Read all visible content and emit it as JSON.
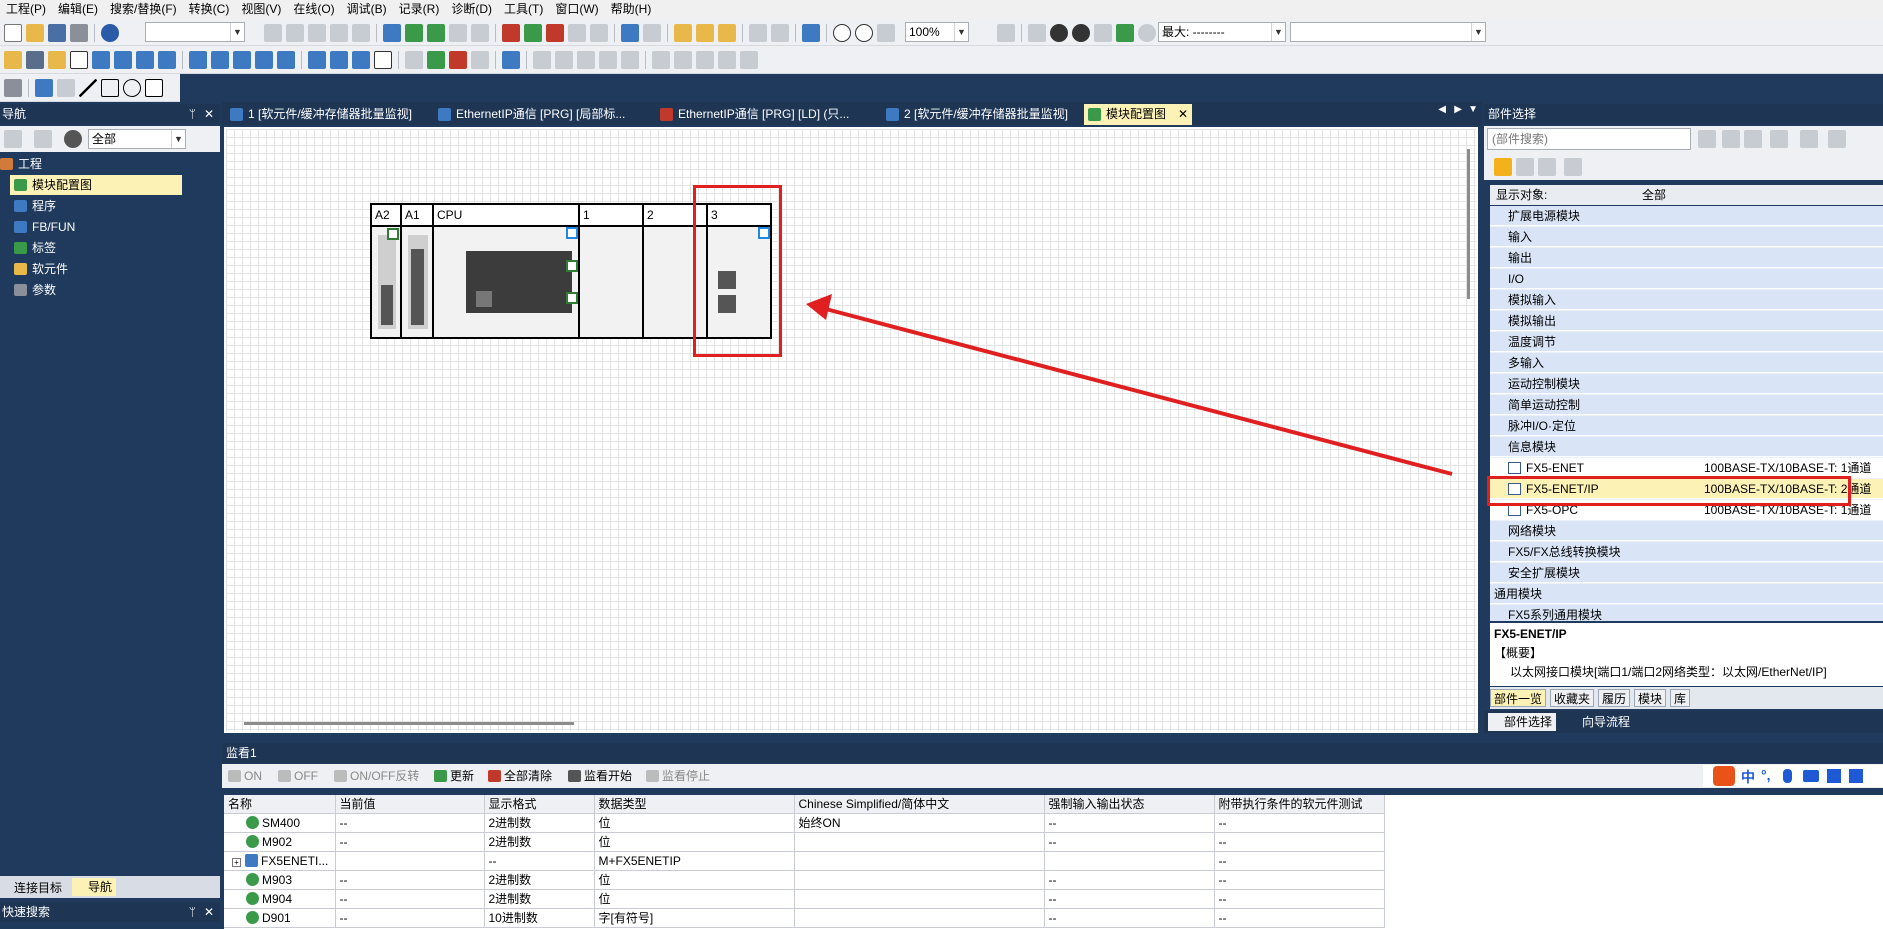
{
  "menu": [
    "工程(P)",
    "编辑(E)",
    "搜索/替换(F)",
    "转换(C)",
    "视图(V)",
    "在线(O)",
    "调试(B)",
    "记录(R)",
    "诊断(D)",
    "工具(T)",
    "窗口(W)",
    "帮助(H)"
  ],
  "toolbar": {
    "zoom": "100%",
    "max_label": "最大: --------"
  },
  "nav": {
    "title": "导航",
    "filter": "全部",
    "tree": [
      {
        "label": "工程",
        "selected": false
      },
      {
        "label": "模块配置图",
        "selected": true
      },
      {
        "label": "程序",
        "selected": false
      },
      {
        "label": "FB/FUN",
        "selected": false
      },
      {
        "label": "标签",
        "selected": false
      },
      {
        "label": "软元件",
        "selected": false
      },
      {
        "label": "参数",
        "selected": false
      }
    ],
    "bottom_tabs": [
      "连接目标",
      "导航"
    ],
    "quick_search": "快速搜索"
  },
  "doc_tabs": [
    "1 [软元件/缓冲存储器批量监视]",
    "EthernetIP通信 [PRG] [局部标...",
    "EthernetIP通信 [PRG] [LD] (只...",
    "2 [软元件/缓冲存储器批量监视]",
    "模块配置图"
  ],
  "modules": {
    "slots": [
      "A2",
      "A1",
      "CPU",
      "1",
      "2",
      "3"
    ]
  },
  "parts": {
    "title": "部件选择",
    "search_placeholder": "(部件搜索)",
    "display_label": "显示对象:",
    "display_value": "全部",
    "items": [
      {
        "label": "扩展电源模块",
        "kind": "cat"
      },
      {
        "label": "输入",
        "kind": "cat"
      },
      {
        "label": "输出",
        "kind": "cat"
      },
      {
        "label": "I/O",
        "kind": "cat"
      },
      {
        "label": "模拟输入",
        "kind": "cat"
      },
      {
        "label": "模拟输出",
        "kind": "cat"
      },
      {
        "label": "温度调节",
        "kind": "cat"
      },
      {
        "label": "多输入",
        "kind": "cat"
      },
      {
        "label": "运动控制模块",
        "kind": "cat"
      },
      {
        "label": "简单运动控制",
        "kind": "cat"
      },
      {
        "label": "脉冲I/O·定位",
        "kind": "cat"
      },
      {
        "label": "信息模块",
        "kind": "cat"
      },
      {
        "label": "FX5-ENET",
        "kind": "leaf",
        "desc": "100BASE-TX/10BASE-T: 1通道"
      },
      {
        "label": "FX5-ENET/IP",
        "kind": "leaf",
        "desc": "100BASE-TX/10BASE-T: 2通道",
        "selected": true
      },
      {
        "label": "FX5-OPC",
        "kind": "leaf",
        "desc": "100BASE-TX/10BASE-T: 1通道"
      },
      {
        "label": "网络模块",
        "kind": "cat"
      },
      {
        "label": "FX5/FX总线转换模块",
        "kind": "cat"
      },
      {
        "label": "安全扩展模块",
        "kind": "cat"
      },
      {
        "label": "通用模块",
        "kind": "top"
      },
      {
        "label": "FX5系列通用模块",
        "kind": "cat"
      }
    ],
    "detail_title": "FX5-ENET/IP",
    "detail_section": "【概要】",
    "detail_text": "以太网接口模块[端口1/端口2网络类型：以太网/EtherNet/IP]",
    "tabs": [
      "部件一览",
      "收藏夹",
      "履历",
      "模块",
      "库"
    ],
    "bottom_tabs": [
      "部件选择",
      "向导流程"
    ]
  },
  "monitor": {
    "title": "监看1",
    "buttons": [
      "ON",
      "OFF",
      "ON/OFF反转",
      "更新",
      "全部清除",
      "监看开始",
      "监看停止"
    ],
    "columns": [
      "名称",
      "当前值",
      "显示格式",
      "数据类型",
      "Chinese Simplified/简体中文",
      "强制输入输出状态",
      "附带执行条件的软元件测试"
    ],
    "rows": [
      [
        "SM400",
        "--",
        "2进制数",
        "位",
        "始终ON",
        "--",
        "--"
      ],
      [
        "M902",
        "--",
        "2进制数",
        "位",
        "",
        "--",
        "--"
      ],
      [
        "FX5ENETI...",
        "",
        "--",
        "M+FX5ENETIP",
        "",
        "",
        "--"
      ],
      [
        "M903",
        "--",
        "2进制数",
        "位",
        "",
        "--",
        "--"
      ],
      [
        "M904",
        "--",
        "2进制数",
        "位",
        "",
        "--",
        "--"
      ],
      [
        "D901",
        "--",
        "10进制数",
        "字[有符号]",
        "",
        "--",
        "--"
      ]
    ]
  },
  "ime": [
    "中",
    "°,"
  ]
}
